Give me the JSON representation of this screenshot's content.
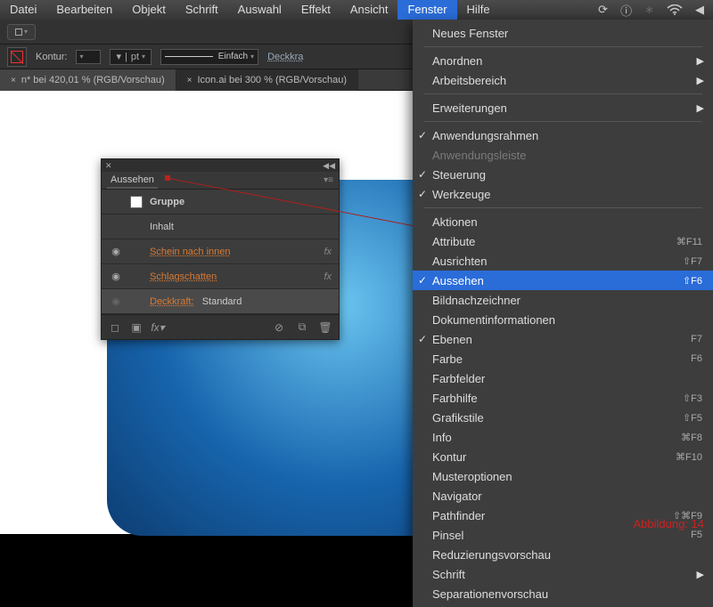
{
  "menubar": {
    "items": [
      "Datei",
      "Bearbeiten",
      "Objekt",
      "Schrift",
      "Auswahl",
      "Effekt",
      "Ansicht",
      "Fenster",
      "Hilfe"
    ],
    "activeIndex": 7
  },
  "toolbar2": {
    "konturLabel": "Kontur:",
    "ptSuffix": "pt",
    "strokeStyle": "Einfach",
    "deckLabel": "Deckkra"
  },
  "tabs": [
    {
      "label": "n* bei 420,01 % (RGB/Vorschau)",
      "active": true
    },
    {
      "label": "Icon.ai bei 300 % (RGB/Vorschau)",
      "active": false
    }
  ],
  "dropdown": {
    "groups": [
      {
        "items": [
          {
            "label": "Neues Fenster"
          }
        ]
      },
      {
        "items": [
          {
            "label": "Anordnen",
            "sub": true
          },
          {
            "label": "Arbeitsbereich",
            "sub": true
          }
        ]
      },
      {
        "items": [
          {
            "label": "Erweiterungen",
            "sub": true
          }
        ]
      },
      {
        "items": [
          {
            "label": "Anwendungsrahmen",
            "check": true
          },
          {
            "label": "Anwendungsleiste",
            "disabled": true
          },
          {
            "label": "Steuerung",
            "check": true
          },
          {
            "label": "Werkzeuge",
            "check": true
          }
        ]
      },
      {
        "items": [
          {
            "label": "Aktionen"
          },
          {
            "label": "Attribute",
            "shortcut": "⌘F11"
          },
          {
            "label": "Ausrichten",
            "shortcut": "⇧F7"
          },
          {
            "label": "Aussehen",
            "shortcut": "⇧F6",
            "check": true,
            "selected": true
          },
          {
            "label": "Bildnachzeichner"
          },
          {
            "label": "Dokumentinformationen"
          },
          {
            "label": "Ebenen",
            "shortcut": "F7",
            "check": true
          },
          {
            "label": "Farbe",
            "shortcut": "F6"
          },
          {
            "label": "Farbfelder"
          },
          {
            "label": "Farbhilfe",
            "shortcut": "⇧F3"
          },
          {
            "label": "Grafikstile",
            "shortcut": "⇧F5"
          },
          {
            "label": "Info",
            "shortcut": "⌘F8"
          },
          {
            "label": "Kontur",
            "shortcut": "⌘F10"
          },
          {
            "label": "Musteroptionen"
          },
          {
            "label": "Navigator"
          },
          {
            "label": "Pathfinder",
            "shortcut": "⇧⌘F9"
          },
          {
            "label": "Pinsel",
            "shortcut": "F5"
          },
          {
            "label": "Reduzierungsvorschau"
          },
          {
            "label": "Schrift",
            "sub": true
          },
          {
            "label": "Separationenvorschau"
          }
        ]
      }
    ]
  },
  "panel": {
    "title": "Aussehen",
    "rows": [
      {
        "type": "head",
        "label": "Gruppe"
      },
      {
        "type": "sub",
        "label": "Inhalt"
      },
      {
        "type": "fx",
        "label": "Schein nach innen"
      },
      {
        "type": "fx",
        "label": "Schlagschatten"
      },
      {
        "type": "opacity",
        "label": "Deckkraft:",
        "value": "Standard",
        "selected": true
      }
    ]
  },
  "caption": "Abbildung: 14"
}
